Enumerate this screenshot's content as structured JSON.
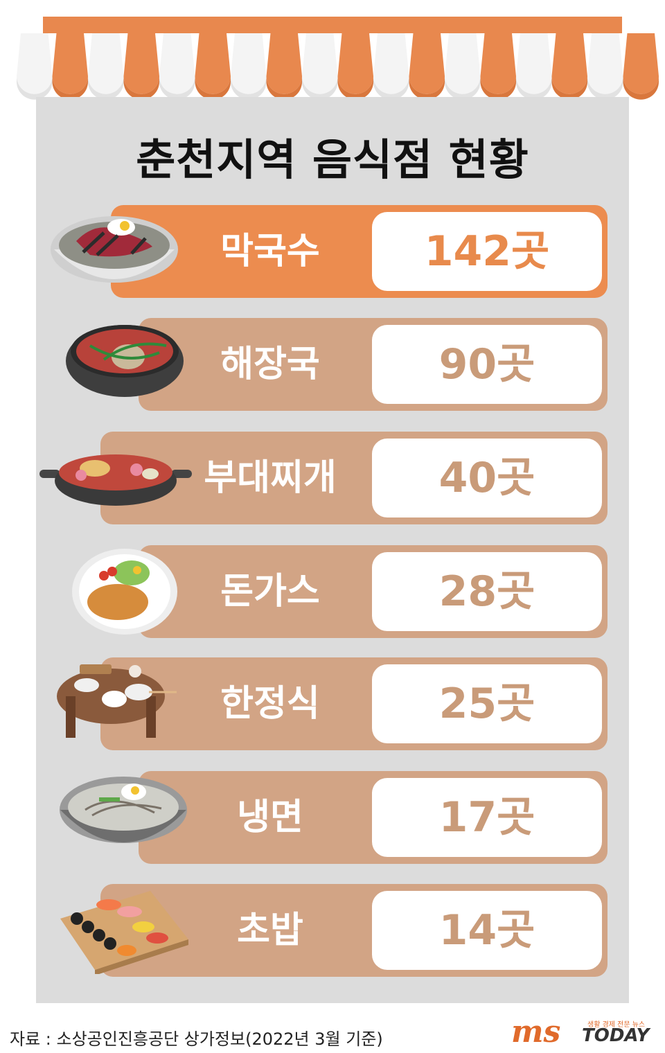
{
  "title": "춘천지역 음식점 현황",
  "chart_data": {
    "type": "table",
    "title": "춘천지역 음식점 현황",
    "categories": [
      "막국수",
      "해장국",
      "부대찌개",
      "돈가스",
      "한정식",
      "냉면",
      "초밥"
    ],
    "values": [
      142,
      90,
      40,
      28,
      25,
      17,
      14
    ],
    "value_labels": [
      "142곳",
      "90곳",
      "40곳",
      "28곳",
      "25곳",
      "17곳",
      "14곳"
    ],
    "unit": "곳"
  },
  "colors": {
    "highlight": "#ec8c4f",
    "band": "#d2a485",
    "value_text_highlight": "#e88a4c",
    "value_text": "#c99b79",
    "panel": "#dcdcdc"
  },
  "footer": {
    "source": "자료 : 소상공인진흥공단 상가정보(2022년 3월 기준)"
  },
  "logo": {
    "ms": "ms",
    "today": "TODAY",
    "tagline": "생활 경제 전문 뉴스"
  }
}
